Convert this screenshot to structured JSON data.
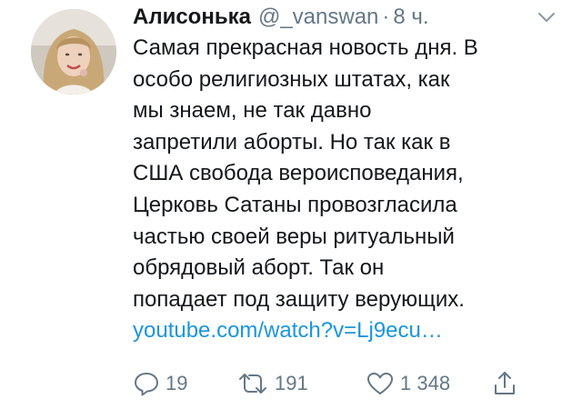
{
  "tweet": {
    "author_name": "Алисонька",
    "author_handle": "@_vanswan",
    "separator": "·",
    "time": "8 ч.",
    "text_lines": [
      "Самая прекрасная новость дня. В",
      "особо религиозных штатах, как",
      "мы знаем, не так давно",
      "запретили аборты. Но так как в",
      "США свобода вероисповедания,",
      "Церковь Сатаны провозгласила",
      "частью своей веры ритуальный",
      "обрядовый аборт. Так он",
      "попадает под защиту верующих."
    ],
    "link": "youtube.com/watch?v=Lj9ecu…"
  },
  "actions": {
    "reply": {
      "count": "19",
      "icon": "reply-icon"
    },
    "retweet": {
      "count": "191",
      "icon": "retweet-icon"
    },
    "like": {
      "count": "1 348",
      "icon": "heart-icon"
    },
    "share": {
      "icon": "share-icon"
    }
  },
  "colors": {
    "text": "#14171a",
    "secondary": "#657786",
    "link": "#1b95e0",
    "background": "#ffffff"
  }
}
